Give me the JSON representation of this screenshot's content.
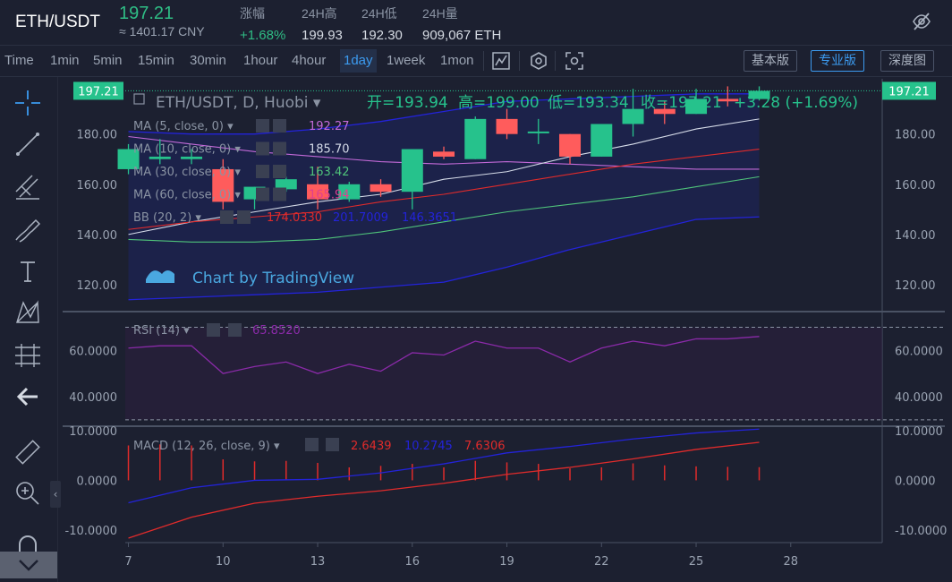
{
  "header": {
    "pair": "ETH/USDT",
    "price": "197.21",
    "price_cny": "≈ 1401.17 CNY",
    "stats": [
      {
        "label": "涨幅",
        "value": "+1.68%",
        "up": true
      },
      {
        "label": "24H高",
        "value": "199.93",
        "up": false
      },
      {
        "label": "24H低",
        "value": "192.30",
        "up": false
      },
      {
        "label": "24H量",
        "value": "909,067 ETH",
        "up": false
      }
    ]
  },
  "toolbar": {
    "timeframes": [
      "Time",
      "1min",
      "5min",
      "15min",
      "30min",
      "1hour",
      "4hour",
      "1day",
      "1week",
      "1mon"
    ],
    "active_timeframe": "1day",
    "views": [
      "基本版",
      "专业版",
      "深度图"
    ],
    "active_view": "专业版"
  },
  "colors": {
    "up": "#26c28c",
    "down": "#ff5c5c",
    "accent": "#3c9bf0"
  },
  "chart_data": [
    {
      "type": "candlestick",
      "title": "ETH/USDT, D, Huobi",
      "ohlc_labels": {
        "open": "开=193.94",
        "high": "高=199.00",
        "low": "低=193.34",
        "close": "收=197.21",
        "change": "+3.28 (+1.69%)"
      },
      "last_price_label": "197.21",
      "watermark": "Chart by TradingView",
      "x_ticks": [
        "7",
        "10",
        "13",
        "16",
        "19",
        "22",
        "25",
        "28"
      ],
      "x_tick_days": [
        7,
        10,
        13,
        16,
        19,
        22,
        25,
        28
      ],
      "x_range": [
        6.9,
        30.9
      ],
      "y_ticks": [
        "120.00",
        "140.00",
        "160.00",
        "180.00"
      ],
      "y_tick_values": [
        120,
        140,
        160,
        180
      ],
      "ylim": [
        110,
        202
      ],
      "candles": [
        {
          "day": 7,
          "open": 166,
          "high": 176,
          "low": 164,
          "close": 174
        },
        {
          "day": 8,
          "open": 170,
          "high": 178,
          "low": 168,
          "close": 171
        },
        {
          "day": 9,
          "open": 170,
          "high": 174,
          "low": 168,
          "close": 171
        },
        {
          "day": 10,
          "open": 166,
          "high": 170,
          "low": 150,
          "close": 153
        },
        {
          "day": 11,
          "open": 154,
          "high": 159,
          "low": 150,
          "close": 159
        },
        {
          "day": 12,
          "open": 158,
          "high": 163,
          "low": 157,
          "close": 162
        },
        {
          "day": 13,
          "open": 160,
          "high": 167,
          "low": 150,
          "close": 154
        },
        {
          "day": 14,
          "open": 154,
          "high": 161,
          "low": 153,
          "close": 160
        },
        {
          "day": 15,
          "open": 160,
          "high": 162,
          "low": 155,
          "close": 157
        },
        {
          "day": 16,
          "open": 157,
          "high": 174,
          "low": 150,
          "close": 174
        },
        {
          "day": 17,
          "open": 173,
          "high": 175,
          "low": 170,
          "close": 171
        },
        {
          "day": 18,
          "open": 170,
          "high": 187,
          "low": 170,
          "close": 186
        },
        {
          "day": 19,
          "open": 186,
          "high": 190,
          "low": 178,
          "close": 180
        },
        {
          "day": 20,
          "open": 181,
          "high": 186,
          "low": 176,
          "close": 181
        },
        {
          "day": 21,
          "open": 180,
          "high": 180,
          "low": 168,
          "close": 171
        },
        {
          "day": 22,
          "open": 171,
          "high": 184,
          "low": 171,
          "close": 184
        },
        {
          "day": 23,
          "open": 184,
          "high": 198,
          "low": 179,
          "close": 190
        },
        {
          "day": 24,
          "open": 190,
          "high": 193,
          "low": 184,
          "close": 188
        },
        {
          "day": 25,
          "open": 188,
          "high": 198,
          "low": 188,
          "close": 194
        },
        {
          "day": 26,
          "open": 194,
          "high": 199,
          "low": 191,
          "close": 193
        },
        {
          "day": 27,
          "open": 193.94,
          "high": 199,
          "low": 193.34,
          "close": 197.21
        }
      ],
      "indicators": [
        {
          "label": "MA (5, close, 0)",
          "value": "192.27",
          "color": "#c36ad8",
          "days": [
            7,
            9,
            11,
            13,
            15,
            17,
            19,
            21,
            23,
            25,
            27
          ],
          "values": [
            179,
            176,
            173,
            171,
            169,
            168,
            169,
            168,
            167,
            166,
            166
          ]
        },
        {
          "label": "MA (10, close, 0)",
          "value": "185.70",
          "color": "#d5dbe8",
          "days": [
            7,
            9,
            11,
            13,
            15,
            17,
            19,
            21,
            23,
            25,
            27
          ],
          "values": [
            140,
            145,
            149,
            153,
            156,
            162,
            165,
            171,
            176,
            182,
            186
          ]
        },
        {
          "label": "MA (30, close, 0)",
          "value": "163.42",
          "color": "#4fc37a",
          "days": [
            7,
            9,
            11,
            13,
            15,
            17,
            19,
            21,
            23,
            25,
            27
          ],
          "values": [
            138,
            137,
            137,
            138,
            141,
            145,
            149,
            152,
            155,
            159,
            163
          ]
        },
        {
          "label": "MA (60, close, 0)",
          "value": "165.94",
          "color": "#e0408f",
          "days": [],
          "values": []
        },
        {
          "label": "BB (20, 2)",
          "value": "174.0330",
          "color": "#e02b2b",
          "days": [
            7,
            9,
            11,
            13,
            15,
            17,
            19,
            21,
            23,
            25,
            27
          ],
          "values": [
            142,
            145,
            147,
            149,
            153,
            156,
            160,
            164,
            168,
            171,
            174
          ]
        }
      ],
      "bb_extra_values": [
        "201.7009",
        "146.3651"
      ],
      "bb_upper": {
        "color": "#2323d9",
        "days": [
          7,
          9,
          11,
          13,
          15,
          17,
          19,
          21,
          23,
          25,
          27
        ],
        "values": [
          181,
          180,
          180,
          182,
          185,
          189,
          193,
          194,
          195,
          196,
          196
        ]
      },
      "bb_lower": {
        "color": "#2323d9",
        "days": [
          7,
          9,
          11,
          13,
          15,
          17,
          19,
          21,
          23,
          25,
          27
        ],
        "values": [
          114,
          115,
          116,
          117,
          119,
          121,
          127,
          134,
          140,
          146,
          147
        ]
      }
    },
    {
      "type": "line",
      "title": "RSI (14)",
      "value": "65.8520",
      "color": "#8a2aa8",
      "y_ticks": [
        "40.0000",
        "60.0000"
      ],
      "y_tick_values": [
        40,
        60
      ],
      "ylim": [
        28,
        76
      ],
      "bands": [
        70,
        30
      ],
      "days": [
        7,
        8,
        9,
        10,
        11,
        12,
        13,
        14,
        15,
        16,
        17,
        18,
        19,
        20,
        21,
        22,
        23,
        24,
        25,
        26,
        27
      ],
      "values": [
        61,
        62,
        62,
        50,
        53,
        55,
        50,
        54,
        51,
        59,
        58,
        64,
        61,
        61,
        55,
        61,
        64,
        62,
        65,
        65,
        66
      ]
    },
    {
      "type": "bar+line",
      "title": "MACD (12, 26, close, 9)",
      "values_text": [
        "2.6439",
        "10.2745",
        "7.6306"
      ],
      "y_ticks": [
        "-10.0000",
        "0.0000",
        "10.0000"
      ],
      "y_tick_values": [
        -10,
        0,
        10
      ],
      "ylim": [
        -12.5,
        10.5
      ],
      "histogram": {
        "color": "#e02b2b",
        "days": [
          7,
          8,
          9,
          10,
          11,
          12,
          13,
          14,
          15,
          16,
          17,
          18,
          19,
          20,
          21,
          22,
          23,
          24,
          25,
          26,
          27
        ],
        "values": [
          7,
          7.2,
          7,
          4.2,
          3.8,
          3.9,
          3.5,
          2.6,
          2.9,
          3.3,
          2.6,
          3.9,
          3.6,
          3.3,
          2.4,
          2.6,
          3.4,
          3.0,
          2.8,
          2.7,
          2.64
        ]
      },
      "macd_line": {
        "color": "#2323d9",
        "days": [
          7,
          9,
          11,
          13,
          15,
          17,
          19,
          21,
          23,
          25,
          27
        ],
        "values": [
          -4.5,
          -1.5,
          0,
          0.2,
          1.5,
          3.3,
          5.5,
          6.8,
          8.3,
          9.5,
          10.27
        ]
      },
      "signal_line": {
        "color": "#e02b2b",
        "days": [
          7,
          9,
          11,
          13,
          15,
          17,
          19,
          21,
          23,
          25,
          27
        ],
        "values": [
          -11.6,
          -7.4,
          -4.6,
          -3.2,
          -2.1,
          -0.6,
          1.2,
          2.6,
          4.3,
          6.2,
          7.63
        ]
      }
    }
  ]
}
